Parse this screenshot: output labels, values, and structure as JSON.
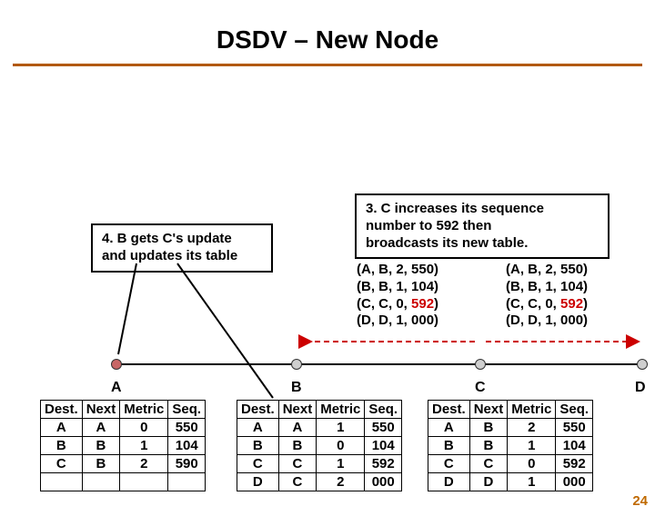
{
  "title": "DSDV – New Node",
  "box3": {
    "l1": "3. C increases its sequence",
    "l2": "number to 592 then",
    "l3": "broadcasts its new table."
  },
  "box4": {
    "l1": "4. B gets C's update",
    "l2": "and updates its table"
  },
  "routesL": {
    "r0": "(A, B, 2, 550)",
    "r1": "(B, B, 1, 104)",
    "r2a": "(C, C, 0, ",
    "r2b": "592",
    "r2c": ")",
    "r3": "(D, D, 1, 000)"
  },
  "routesR": {
    "r0": "(A, B, 2, 550)",
    "r1": "(B, B, 1, 104)",
    "r2a": "(C, C, 0, ",
    "r2b": "592",
    "r2c": ")",
    "r3": "(D, D, 1, 000)"
  },
  "nodes": {
    "A": "A",
    "B": "B",
    "C": "C",
    "D": "D"
  },
  "headers": {
    "dest": "Dest.",
    "next": "Next",
    "metric": "Metric",
    "seq": "Seq."
  },
  "tableA": [
    {
      "dest": "A",
      "next": "A",
      "metric": "0",
      "seq": "550"
    },
    {
      "dest": "B",
      "next": "B",
      "metric": "1",
      "seq": "104"
    },
    {
      "dest": "C",
      "next": "B",
      "metric": "2",
      "seq": "590"
    }
  ],
  "tableB": [
    {
      "dest": "A",
      "next": "A",
      "metric": "1",
      "seq": "550"
    },
    {
      "dest": "B",
      "next": "B",
      "metric": "0",
      "seq": "104"
    },
    {
      "dest": "C",
      "next": "C",
      "metric": "1",
      "seq": "592"
    },
    {
      "dest": "D",
      "next": "C",
      "metric": "2",
      "seq": "000"
    }
  ],
  "tableC": [
    {
      "dest": "A",
      "next": "B",
      "metric": "2",
      "seq": "550"
    },
    {
      "dest": "B",
      "next": "B",
      "metric": "1",
      "seq": "104"
    },
    {
      "dest": "C",
      "next": "C",
      "metric": "0",
      "seq": "592"
    },
    {
      "dest": "D",
      "next": "D",
      "metric": "1",
      "seq": "000"
    }
  ],
  "slidenum": "24"
}
